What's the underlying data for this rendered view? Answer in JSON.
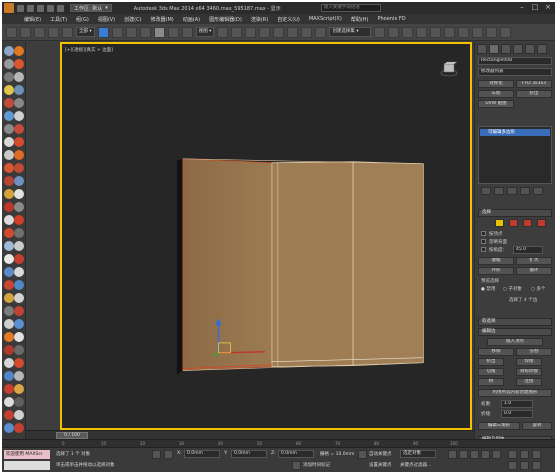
{
  "titlebar": {
    "workspace_label": "工作区: 默认",
    "app_title": "Autodesk 3ds Max  2014 x64    3460.max_595187.max - 显示",
    "search_placeholder": "键入关键字或短语"
  },
  "menus": [
    "编辑(E)",
    "工具(T)",
    "组(G)",
    "视图(V)",
    "创建(C)",
    "修改器(M)",
    "动画(A)",
    "图形编辑器(D)",
    "渲染(R)",
    "自定义(U)",
    "MAXScript(X)",
    "帮助(H)",
    "Phoenix FD"
  ],
  "toolbar": {
    "filter_select": "全部",
    "view_select": "视图",
    "selection_set": "创建选择集"
  },
  "viewport": {
    "label": "[+][透视][真实 + 边面]"
  },
  "command_panel": {
    "object_name": "Rectangle008",
    "modifier_list": "修改器列表",
    "btn_symmetry": "对称化",
    "btn_ffd": "FFD 3x3x3",
    "btn_lathe": "车削",
    "btn_extrude": "挤出",
    "btn_uvw": "UVW 贴图",
    "stack_item": "可编辑多边形",
    "rollout_selection": "选择",
    "check_by_vertex": "按顶点",
    "check_ignore_backfacing": "忽略背面",
    "check_by_angle": "按角度:",
    "angle_value": "45.0",
    "btn_shrink": "收缩",
    "btn_grow": "扩大",
    "btn_ring": "环形",
    "btn_loop": "循环",
    "preview_label": "预览选择",
    "radio_disabled": "禁用",
    "radio_subobj": "子对象",
    "radio_multi": "多个",
    "selection_status": "选择了 4 个边",
    "rollout_soft": "软选择",
    "rollout_edit_edges": "编辑边",
    "btn_insert_vertex": "插入顶点",
    "btn_remove": "移除",
    "btn_split": "分割",
    "btn_extrude_e": "挤出",
    "btn_weld": "焊接",
    "btn_chamfer": "切角",
    "btn_target_weld": "目标焊接",
    "btn_bridge": "桥",
    "btn_connect": "连接",
    "btn_create_shape": "利用所选内容创建图形",
    "weight_label": "权重:",
    "weight_value": "1.0",
    "crease_label": "折缝:",
    "crease_value": "0.0",
    "btn_edit_tri": "编辑三角形",
    "btn_turn": "旋转",
    "rollout_edit_geometry": "编辑几何体"
  },
  "timeline": {
    "frame_display": "0 / 100",
    "ticks": [
      "0",
      "10",
      "20",
      "30",
      "40",
      "50",
      "60",
      "70",
      "80",
      "90",
      "100"
    ]
  },
  "status": {
    "maxscript": "欢迎使用 MAXScr",
    "selection_status": "选择了 1 个 对象",
    "prompt": "单击或单击并拖动以选择对象",
    "x_label": "X:",
    "x_value": "0.0mm",
    "y_label": "Y:",
    "y_value": "0.0mm",
    "z_label": "Z:",
    "z_value": "0.0mm",
    "grid": "栅格 = 10.0mm",
    "add_time_tag": "添加时间标记",
    "auto_key": "自动关键点",
    "set_key": "设置关键点",
    "selected_object": "选定对象",
    "key_filters": "关键点过滤器..."
  }
}
